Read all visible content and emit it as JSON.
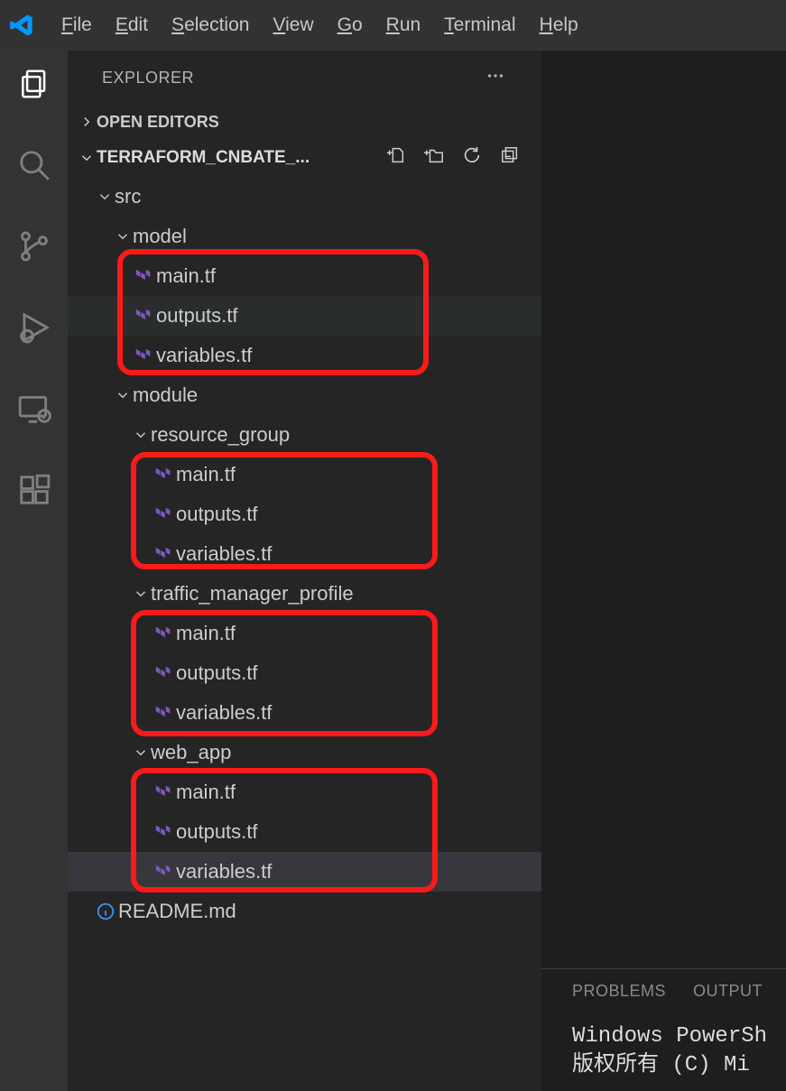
{
  "menu": {
    "items": [
      {
        "mn": "F",
        "rest": "ile"
      },
      {
        "mn": "E",
        "rest": "dit"
      },
      {
        "mn": "S",
        "rest": "election"
      },
      {
        "mn": "V",
        "rest": "iew"
      },
      {
        "mn": "G",
        "rest": "o"
      },
      {
        "mn": "R",
        "rest": "un"
      },
      {
        "mn": "T",
        "rest": "erminal"
      },
      {
        "mn": "H",
        "rest": "elp"
      }
    ]
  },
  "sidebar": {
    "title": "EXPLORER",
    "openEditors": "OPEN EDITORS",
    "projectName": "TERRAFORM_CNBATE_...",
    "tree": {
      "src": "src",
      "model": "model",
      "model_files": [
        "main.tf",
        "outputs.tf",
        "variables.tf"
      ],
      "module": "module",
      "resource_group": "resource_group",
      "rg_files": [
        "main.tf",
        "outputs.tf",
        "variables.tf"
      ],
      "traffic_manager_profile": "traffic_manager_profile",
      "tmp_files": [
        "main.tf",
        "outputs.tf",
        "variables.tf"
      ],
      "web_app": "web_app",
      "wa_files": [
        "main.tf",
        "outputs.tf",
        "variables.tf"
      ],
      "readme": "README.md"
    }
  },
  "panel": {
    "tabs": [
      "PROBLEMS",
      "OUTPUT"
    ],
    "line1": "Windows PowerSh",
    "line2": "版权所有 (C) Mi"
  }
}
